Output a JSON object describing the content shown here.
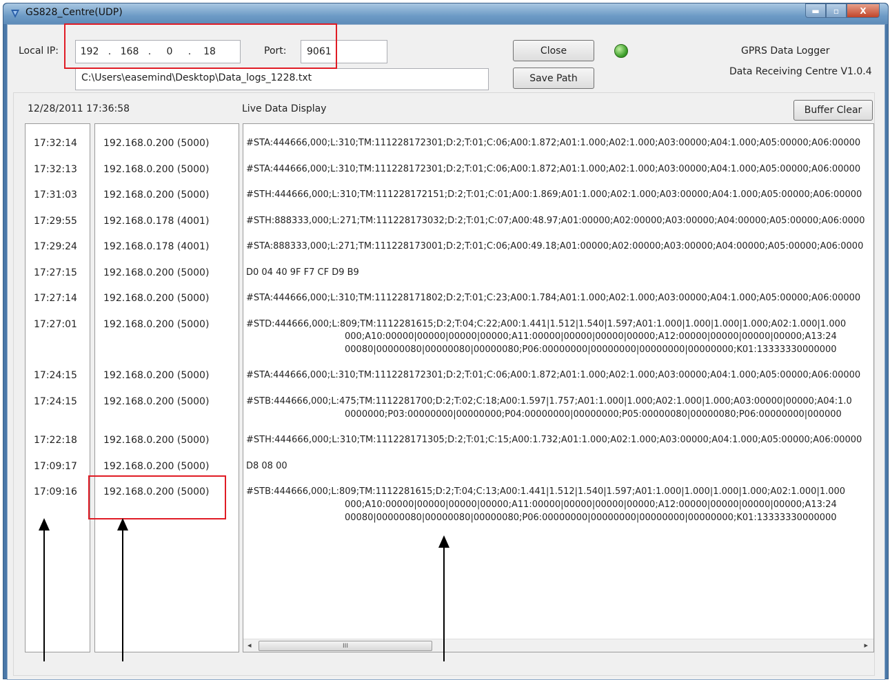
{
  "window": {
    "title": "GS828_Centre(UDP)",
    "controls": {
      "minimize": "▬",
      "maximize": "▫",
      "close": "X"
    }
  },
  "connection": {
    "local_ip_label": "Local IP:",
    "ip_octets": [
      "192",
      "168",
      "0",
      "18"
    ],
    "ip_separator": ".",
    "port_label": "Port:",
    "port_value": "9061",
    "log_path": "C:\\Users\\easemind\\Desktop\\Data_logs_1228.txt"
  },
  "buttons": {
    "close": "Close",
    "save_path": "Save Path",
    "buffer_clear": "Buffer Clear"
  },
  "status_led_color": "#3c9e2a",
  "app_info": {
    "name": "GPRS Data Logger",
    "version": "Data Receiving Centre V1.0.4"
  },
  "panel": {
    "datetime": "12/28/2011 17:36:58",
    "live_label": "Live Data Display"
  },
  "log": [
    {
      "time": "17:32:14",
      "source": "192.168.0.200 (5000)",
      "data": [
        "#STA:444666,000;L:310;TM:111228172301;D:2;T:01;C:06;A00:1.872;A01:1.000;A02:1.000;A03:00000;A04:1.000;A05:00000;A06:00000"
      ]
    },
    {
      "time": "17:32:13",
      "source": "192.168.0.200 (5000)",
      "data": [
        "#STA:444666,000;L:310;TM:111228172301;D:2;T:01;C:06;A00:1.872;A01:1.000;A02:1.000;A03:00000;A04:1.000;A05:00000;A06:00000"
      ]
    },
    {
      "time": "17:31:03",
      "source": "192.168.0.200 (5000)",
      "data": [
        "#STH:444666,000;L:310;TM:111228172151;D:2;T:01;C:01;A00:1.869;A01:1.000;A02:1.000;A03:00000;A04:1.000;A05:00000;A06:00000"
      ]
    },
    {
      "time": "17:29:55",
      "source": "192.168.0.178 (4001)",
      "data": [
        "#STH:888333,000;L:271;TM:111228173032;D:2;T:01;C:07;A00:48.97;A01:00000;A02:00000;A03:00000;A04:00000;A05:00000;A06:0000"
      ]
    },
    {
      "time": "17:29:24",
      "source": "192.168.0.178 (4001)",
      "data": [
        "#STA:888333,000;L:271;TM:111228173001;D:2;T:01;C:06;A00:49.18;A01:00000;A02:00000;A03:00000;A04:00000;A05:00000;A06:0000"
      ]
    },
    {
      "time": "17:27:15",
      "source": "192.168.0.200 (5000)",
      "data": [
        "D0 04 40 9F F7 CF D9 B9"
      ]
    },
    {
      "time": "17:27:14",
      "source": "192.168.0.200 (5000)",
      "data": [
        "#STA:444666,000;L:310;TM:111228171802;D:2;T:01;C:23;A00:1.784;A01:1.000;A02:1.000;A03:00000;A04:1.000;A05:00000;A06:00000"
      ]
    },
    {
      "time": "17:27:01",
      "source": "192.168.0.200 (5000)",
      "data": [
        "#STD:444666,000;L:809;TM:1112281615;D:2;T:04;C:22;A00:1.441|1.512|1.540|1.597;A01:1.000|1.000|1.000|1.000;A02:1.000|1.000",
        "000;A10:00000|00000|00000|00000;A11:00000|00000|00000|00000;A12:00000|00000|00000|00000;A13:24",
        "00080|00000080|00000080|00000080;P06:00000000|00000000|00000000|00000000;K01:13333330000000"
      ]
    },
    {
      "time": "17:24:15",
      "source": "192.168.0.200 (5000)",
      "data": [
        "#STA:444666,000;L:310;TM:111228172301;D:2;T:01;C:06;A00:1.872;A01:1.000;A02:1.000;A03:00000;A04:1.000;A05:00000;A06:00000"
      ]
    },
    {
      "time": "17:24:15",
      "source": "192.168.0.200 (5000)",
      "data": [
        "#STB:444666,000;L:475;TM:1112281700;D:2;T:02;C:18;A00:1.597|1.757;A01:1.000|1.000;A02:1.000|1.000;A03:00000|00000;A04:1.0",
        "0000000;P03:00000000|00000000;P04:00000000|00000000;P05:00000080|00000080;P06:00000000|000000"
      ]
    },
    {
      "time": "17:22:18",
      "source": "192.168.0.200 (5000)",
      "data": [
        "#STH:444666,000;L:310;TM:111228171305;D:2;T:01;C:15;A00:1.732;A01:1.000;A02:1.000;A03:00000;A04:1.000;A05:00000;A06:00000"
      ]
    },
    {
      "time": "17:09:17",
      "source": "192.168.0.200 (5000)",
      "data": [
        "D8 08 00"
      ]
    },
    {
      "time": "17:09:16",
      "source": "192.168.0.200 (5000)",
      "data": [
        "#STB:444666,000;L:809;TM:1112281615;D:2;T:04;C:13;A00:1.441|1.512|1.540|1.597;A01:1.000|1.000|1.000|1.000;A02:1.000|1.000",
        "000;A10:00000|00000|00000|00000;A11:00000|00000|00000|00000;A12:00000|00000|00000|00000;A13:24",
        "00080|00000080|00000080|00000080;P06:00000000|00000000|00000000|00000000;K01:13333330000000"
      ]
    }
  ],
  "scrollbar": {
    "thumb_glyph": "III",
    "left_arrow": "◂",
    "right_arrow": "▸"
  }
}
